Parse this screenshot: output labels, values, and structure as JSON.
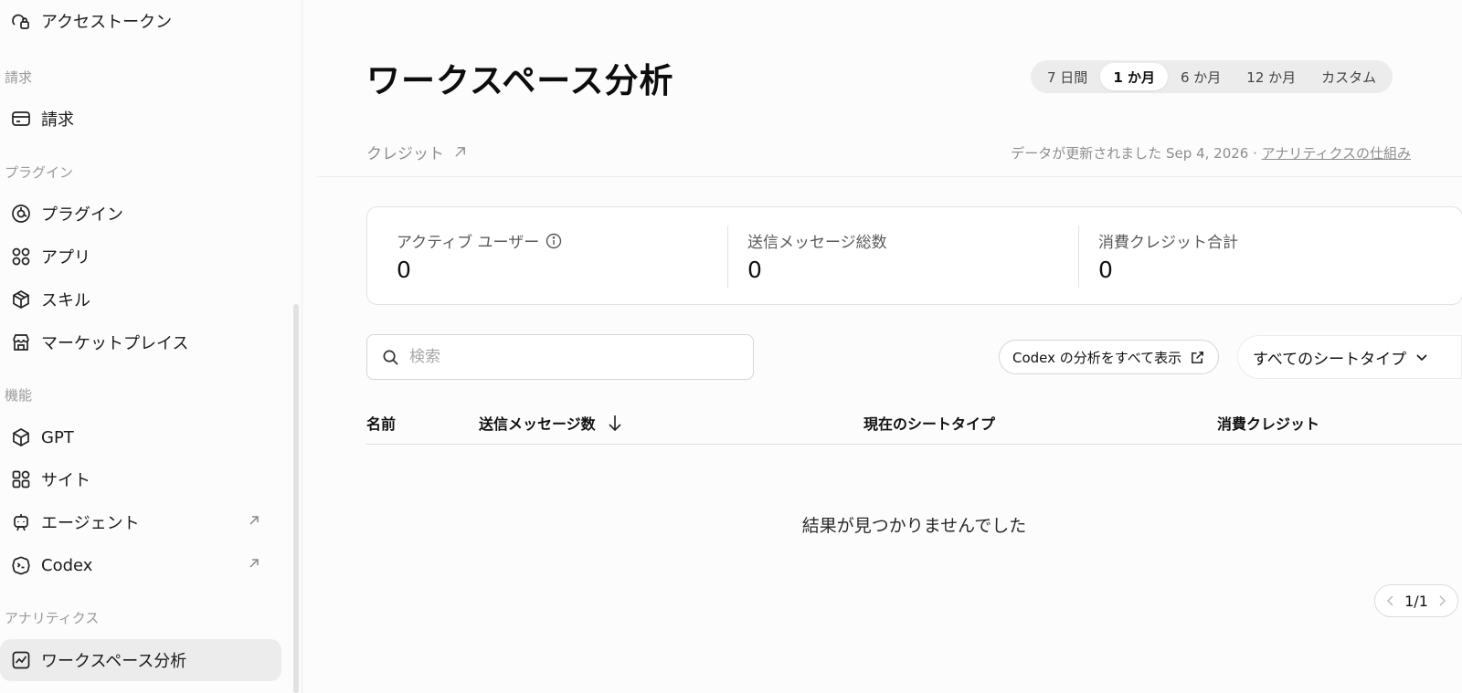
{
  "sidebar": {
    "top_item": {
      "label": "アクセストークン",
      "icon": "access-token-icon"
    },
    "sections": [
      {
        "label": "請求"
      },
      {
        "label": "プラグイン"
      },
      {
        "label": "機能"
      },
      {
        "label": "アナリティクス"
      }
    ],
    "items": [
      {
        "label": "請求",
        "icon": "billing-card-icon"
      },
      {
        "label": "プラグイン",
        "icon": "plugin-icon"
      },
      {
        "label": "アプリ",
        "icon": "apps-grid-icon"
      },
      {
        "label": "スキル",
        "icon": "skill-cube-icon"
      },
      {
        "label": "マーケットプレイス",
        "icon": "marketplace-store-icon"
      },
      {
        "label": "GPT",
        "icon": "gpt-box-icon"
      },
      {
        "label": "サイト",
        "icon": "sites-icon"
      },
      {
        "label": "エージェント",
        "icon": "agent-robot-icon",
        "external": true
      },
      {
        "label": "Codex",
        "icon": "codex-icon",
        "external": true
      },
      {
        "label": "ワークスペース分析",
        "icon": "analytics-chart-icon",
        "active": true
      }
    ]
  },
  "header": {
    "title": "ワークスペース分析",
    "ranges": [
      "7 日間",
      "1 か月",
      "6 か月",
      "12 か月",
      "カスタム"
    ],
    "selected_range": "1 か月",
    "credit_link": "クレジット",
    "updated_prefix": "データが更新されました Sep 4, 2026 · ",
    "updated_link": "アナリティクスの仕組み"
  },
  "stats": [
    {
      "label": "アクティブ ユーザー",
      "value": "0",
      "info": true
    },
    {
      "label": "送信メッセージ総数",
      "value": "0"
    },
    {
      "label": "消費クレジット合計",
      "value": "0"
    }
  ],
  "search": {
    "placeholder": "検索",
    "value": ""
  },
  "codex_button": "Codex の分析をすべて表示",
  "seat_filter": "すべてのシートタイプ",
  "table": {
    "columns": [
      "名前",
      "送信メッセージ数",
      "現在のシートタイプ",
      "消費クレジット"
    ],
    "sort_column": "送信メッセージ数",
    "rows": [],
    "empty_message": "結果が見つかりませんでした"
  },
  "pagination": {
    "label": "1/1"
  },
  "colors": {
    "active_bg": "#ececec",
    "muted_text": "#8e8e8e",
    "border": "#e2e2e2"
  }
}
